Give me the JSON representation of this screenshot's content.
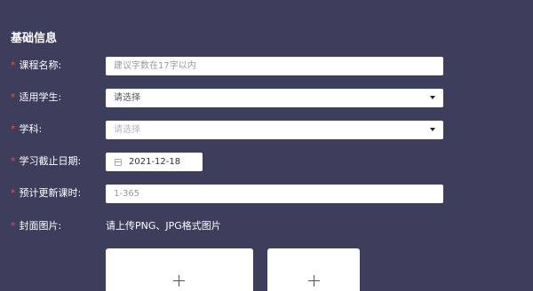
{
  "section": {
    "title": "基础信息"
  },
  "form": {
    "required_mark": "*",
    "course_name": {
      "label": "课程名称:",
      "placeholder": "建议字数在17字以内"
    },
    "students": {
      "label": "适用学生:",
      "value": "请选择"
    },
    "subject": {
      "label": "学科:",
      "value": "请选择"
    },
    "deadline": {
      "label": "学习截止日期:",
      "value": "2021-12-18",
      "icon": "calendar-icon"
    },
    "lesson_count": {
      "label": "预计更新课时:",
      "placeholder": "1-365"
    },
    "cover": {
      "label": "封面图片:",
      "hint": "请上传PNG、JPG格式图片"
    }
  },
  "uploads": [
    {
      "icon": "plus-icon"
    },
    {
      "icon": "plus-icon"
    }
  ]
}
